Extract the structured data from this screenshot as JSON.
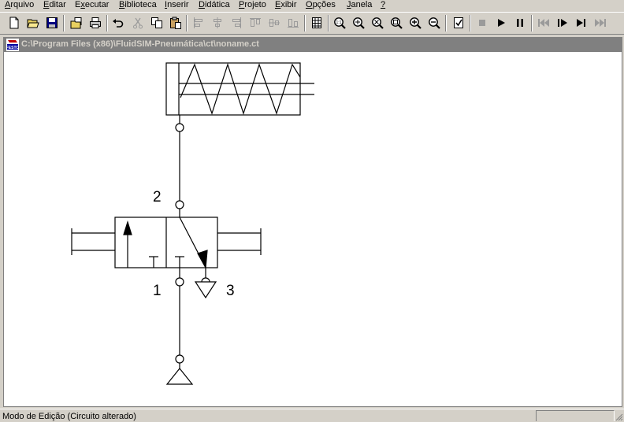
{
  "menu": {
    "arquivo": {
      "u": "A",
      "rest": "rquivo"
    },
    "editar": {
      "u": "E",
      "rest": "ditar"
    },
    "executar": {
      "pre": "E",
      "u": "x",
      "rest": "ecutar"
    },
    "biblioteca": {
      "u": "B",
      "rest": "iblioteca"
    },
    "inserir": {
      "u": "I",
      "rest": "nserir"
    },
    "didatica": {
      "u": "D",
      "rest": "idática"
    },
    "projeto": {
      "u": "P",
      "rest": "rojeto"
    },
    "exibir": {
      "u": "E",
      "rest": "xibir"
    },
    "opcoes": {
      "u": "O",
      "rest": "pções"
    },
    "janela": {
      "u": "J",
      "rest": "anela"
    },
    "help": {
      "u": "?"
    }
  },
  "window": {
    "title": "C:\\Program Files (x86)\\FluidSIM-Pneumática\\ct\\noname.ct",
    "logo_text": "FESTO"
  },
  "circuit": {
    "port_2": "2",
    "port_1": "1",
    "port_3": "3"
  },
  "status": {
    "text": "Modo de Edição (Circuito alterado)"
  },
  "colors": {
    "chrome": "#d4d0c8",
    "title_bar": "#808080",
    "disabled": "#9a9a9a",
    "canvas": "#ffffff",
    "ink": "#000000"
  }
}
